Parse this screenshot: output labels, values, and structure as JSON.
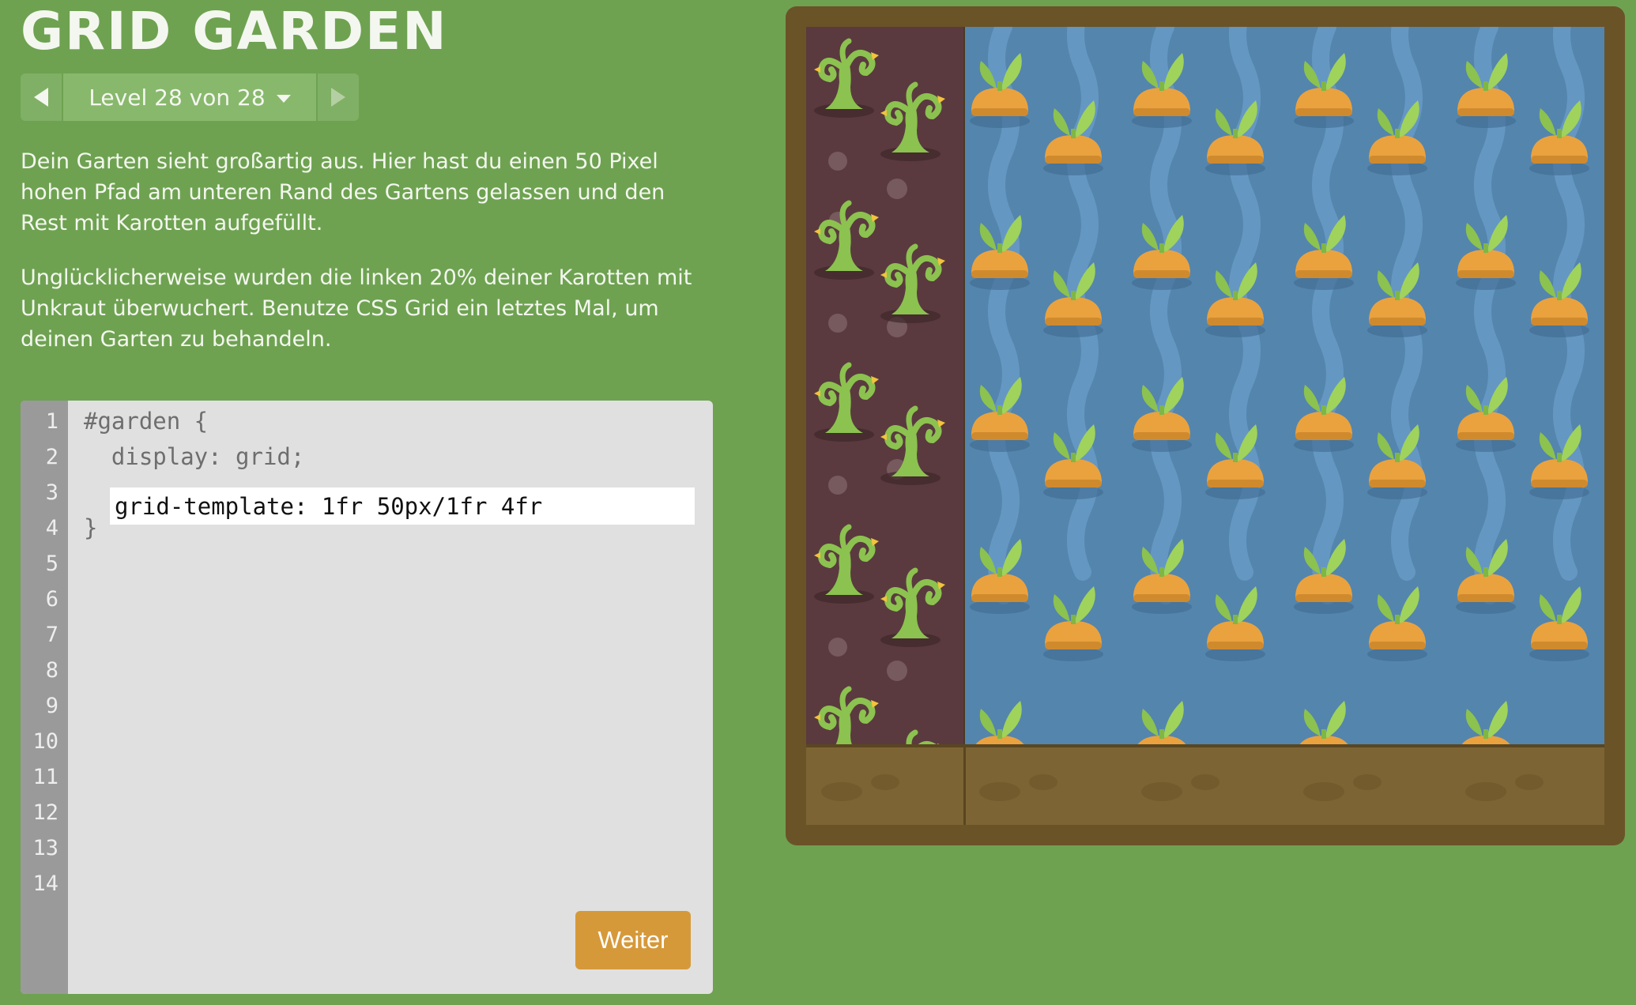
{
  "title": "GRID GARDEN",
  "level_nav": {
    "label": "Level 28 von 28",
    "prev_icon": "chevron-left-icon",
    "next_icon": "chevron-right-icon"
  },
  "instructions": [
    "Dein Garten sieht großartig aus. Hier hast du einen 50 Pixel hohen Pfad am unteren Rand des Gartens gelassen und den Rest mit Karotten aufgefüllt.",
    "Unglücklicherweise wurden die linken 20% deiner Karotten mit Unkraut überwuchert. Benutze CSS Grid ein letztes Mal, um deinen Garten zu behandeln."
  ],
  "editor": {
    "line_numbers": [
      "1",
      "2",
      "3",
      "4",
      "5",
      "6",
      "7",
      "8",
      "9",
      "10",
      "11",
      "12",
      "13",
      "14"
    ],
    "line1": "#garden {",
    "line2": "  display: grid;",
    "input_value": "grid-template: 1fr 50px/1fr 4fr",
    "line4": "}",
    "next_label": "Weiter"
  },
  "colors": {
    "background": "#6ea251",
    "weed_area": "#5a3a3f",
    "carrot_area": "#5485ad",
    "path": "#7d6434",
    "frame": "#6b5328",
    "button": "#d6993a"
  }
}
